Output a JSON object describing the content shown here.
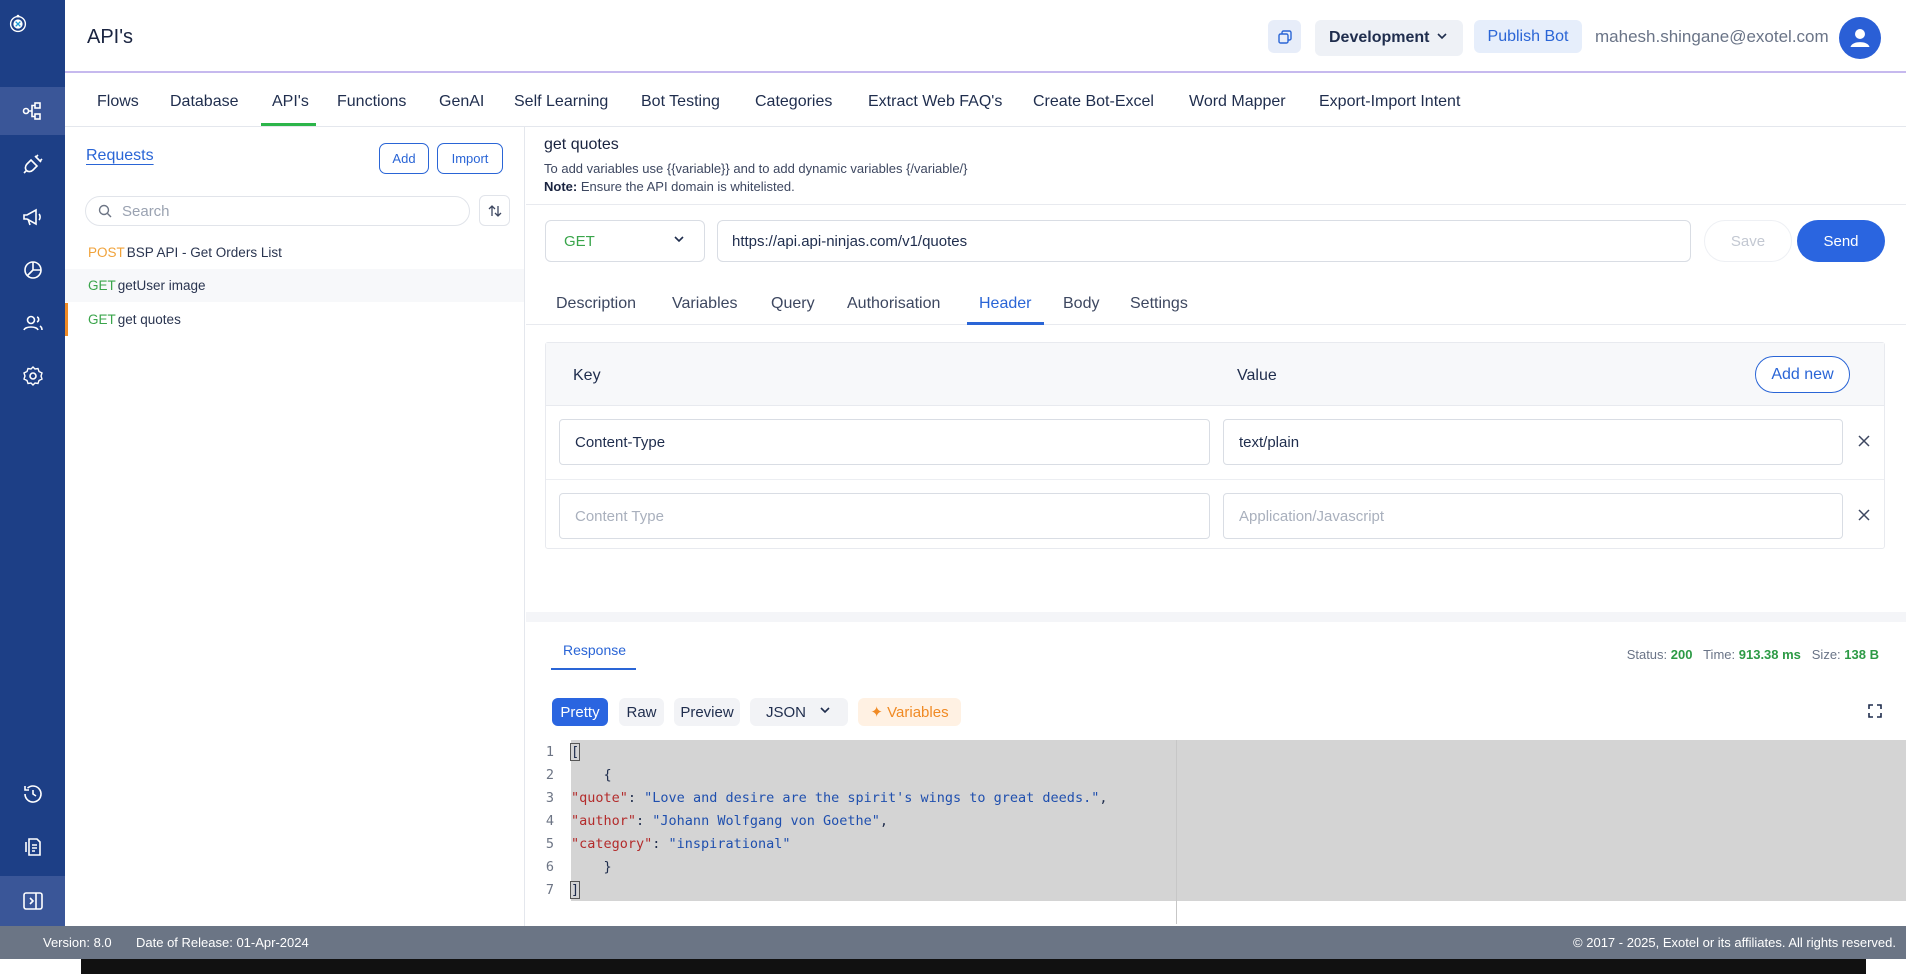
{
  "header": {
    "title": "API's",
    "environment": "Development",
    "publish_label": "Publish Bot",
    "user_email": "mahesh.shingane@exotel.com"
  },
  "topnav": {
    "tabs": [
      "Flows",
      "Database",
      "API's",
      "Functions",
      "GenAI",
      "Self Learning",
      "Bot Testing",
      "Categories",
      "Extract Web FAQ's",
      "Create Bot-Excel",
      "Word Mapper",
      "Export-Import Intent"
    ],
    "active": "API's"
  },
  "left_panel": {
    "title": "Requests",
    "add_label": "Add",
    "import_label": "Import",
    "search_placeholder": "Search",
    "requests": [
      {
        "method": "POST",
        "name": "BSP API - Get Orders List"
      },
      {
        "method": "GET",
        "name": "getUser image"
      },
      {
        "method": "GET",
        "name": "get quotes"
      }
    ]
  },
  "request": {
    "name": "get quotes",
    "hint_line1": "To add variables use {{variable}} and to add dynamic variables {/variable/}",
    "note_label": "Note:",
    "note_text": " Ensure the API domain is whitelisted.",
    "method": "GET",
    "url": "https://api.api-ninjas.com/v1/quotes",
    "save_label": "Save",
    "send_label": "Send"
  },
  "subtabs": {
    "tabs": [
      "Description",
      "Variables",
      "Query",
      "Authorisation",
      "Header",
      "Body",
      "Settings"
    ],
    "active": "Header"
  },
  "headers_table": {
    "key_label": "Key",
    "value_label": "Value",
    "add_new_label": "Add new",
    "rows": [
      {
        "key": "Content-Type",
        "value": "text/plain"
      },
      {
        "key_placeholder": "Content Type",
        "value_placeholder": "Application/Javascript"
      }
    ]
  },
  "response": {
    "tab_label": "Response",
    "status_label": "Status:",
    "status_value": "200",
    "time_label": "Time:",
    "time_value": "913.38 ms",
    "size_label": "Size:",
    "size_value": "138 B",
    "formats": {
      "pretty": "Pretty",
      "raw": "Raw",
      "preview": "Preview",
      "type": "JSON",
      "variables": "✦ Variables"
    },
    "code_lines": [
      "1",
      "2",
      "3",
      "4",
      "5",
      "6",
      "7"
    ],
    "code": {
      "l1": "[",
      "l2": "    {",
      "quote_key": "\"quote\"",
      "quote_val": "\"Love and desire are the spirit's wings to great deeds.\"",
      "author_key": "\"author\"",
      "author_val": "\"Johann Wolfgang von Goethe\"",
      "category_key": "\"category\"",
      "category_val": "\"inspirational\"",
      "l6": "    }",
      "l7": "]"
    }
  },
  "footer": {
    "version": "Version: 8.0",
    "release": "Date of Release: 01-Apr-2024",
    "copyright": "© 2017 - 2025, Exotel or its affiliates. All rights reserved."
  },
  "colors": {
    "rail": "#1d3f86",
    "accent_blue": "#2a65e0",
    "nav_active_underline": "#2cb54a",
    "post_method": "#f0a23a",
    "get_method": "#3aa54b"
  }
}
